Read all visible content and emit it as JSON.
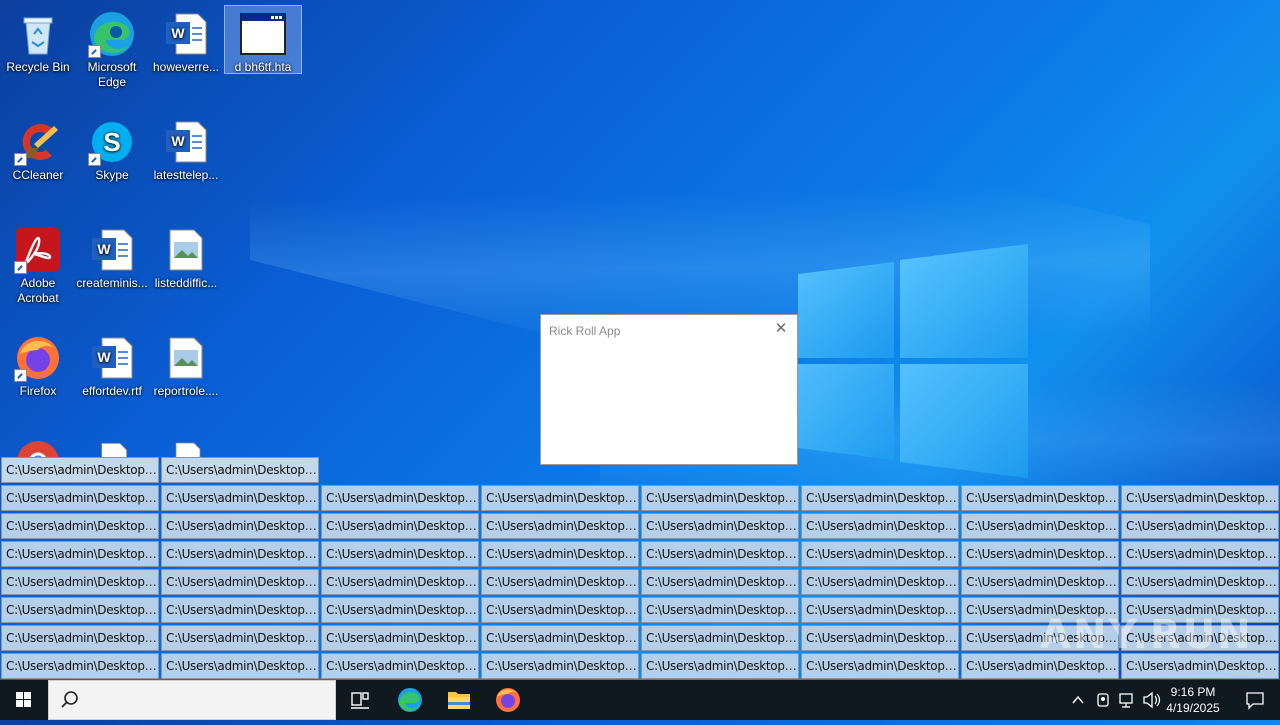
{
  "desktop": {
    "icons": [
      {
        "label": "Recycle Bin",
        "icon": "recycle-bin-icon"
      },
      {
        "label": "Microsoft Edge",
        "icon": "edge-icon"
      },
      {
        "label": "howeverre...",
        "icon": "word-doc-icon"
      },
      {
        "label": "d bh6tf.hta",
        "icon": "hta-window-icon"
      },
      {
        "label": "CCleaner",
        "icon": "ccleaner-icon"
      },
      {
        "label": "Skype",
        "icon": "skype-icon"
      },
      {
        "label": "latesttelep...",
        "icon": "word-doc-icon"
      },
      {
        "label": "Adobe Acrobat",
        "icon": "acrobat-icon"
      },
      {
        "label": "createminis...",
        "icon": "word-doc-icon"
      },
      {
        "label": "listeddiffic...",
        "icon": "image-file-icon"
      },
      {
        "label": "Firefox",
        "icon": "firefox-icon"
      },
      {
        "label": "effortdev.rtf",
        "icon": "word-doc-icon"
      },
      {
        "label": "reportrole....",
        "icon": "image-file-icon"
      }
    ]
  },
  "dialog": {
    "title": "Rick Roll App",
    "close_label": "✕"
  },
  "path_windows": {
    "label": "C:\\Users\\admin\\Desktop\\d...",
    "top_row_count": 2,
    "rows": 7,
    "columns": 8
  },
  "watermark": "ANY.RUN",
  "taskbar": {
    "time": "9:16 PM",
    "date": "4/19/2025",
    "pinned": [
      "task-view-icon",
      "edge-icon",
      "file-explorer-icon",
      "firefox-icon"
    ]
  },
  "colors": {
    "path_bar_bg": "#b6cfe8",
    "taskbar_bg": "#101820",
    "desktop_blue": "#0a5fd6"
  }
}
